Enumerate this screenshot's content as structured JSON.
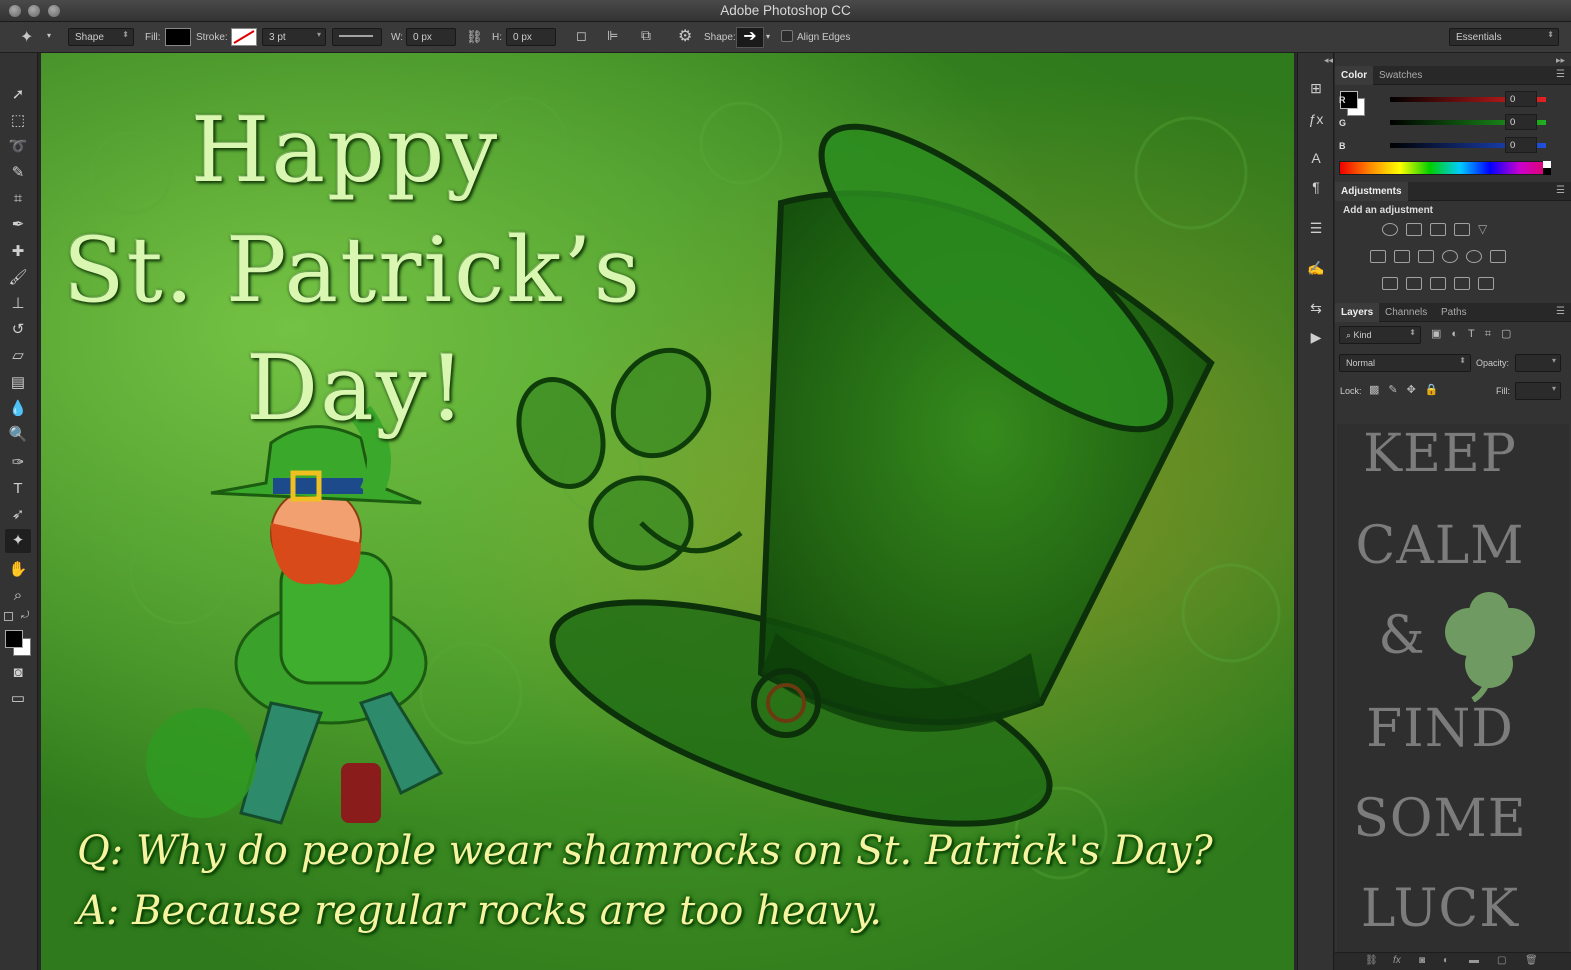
{
  "app": {
    "title": "Adobe Photoshop CC"
  },
  "options_bar": {
    "mode": "Shape",
    "fill_label": "Fill:",
    "stroke_label": "Stroke:",
    "stroke_width": "3 pt",
    "w_label": "W:",
    "w_value": "0 px",
    "h_label": "H:",
    "h_value": "0 px",
    "shape_label": "Shape:",
    "align_edges": "Align Edges",
    "workspace": "Essentials",
    "fill_color": "#000000",
    "stroke_color": "none"
  },
  "canvas": {
    "heading_line1": "Happy",
    "heading_line2": "St. Patrick’s",
    "heading_line3": "Day!",
    "question": "Q: Why do people wear shamrocks on St. Patrick's Day?",
    "answer": "A:  Because regular rocks are too heavy."
  },
  "color_panel": {
    "tabs": [
      "Color",
      "Swatches"
    ],
    "channels": [
      {
        "label": "R",
        "value": "0",
        "color": "#e82020"
      },
      {
        "label": "G",
        "value": "0",
        "color": "#20b020"
      },
      {
        "label": "B",
        "value": "0",
        "color": "#2050e0"
      }
    ]
  },
  "adjustments_panel": {
    "tab": "Adjustments",
    "subtitle": "Add an adjustment"
  },
  "layers_panel": {
    "tabs": [
      "Layers",
      "Channels",
      "Paths"
    ],
    "filter": "Kind",
    "blend_mode": "Normal",
    "opacity_label": "Opacity:",
    "lock_label": "Lock:",
    "fill_label": "Fill:"
  },
  "preview": {
    "lines": [
      "KEEP",
      "CALM",
      "&",
      "FIND",
      "SOME",
      "LUCK"
    ]
  }
}
